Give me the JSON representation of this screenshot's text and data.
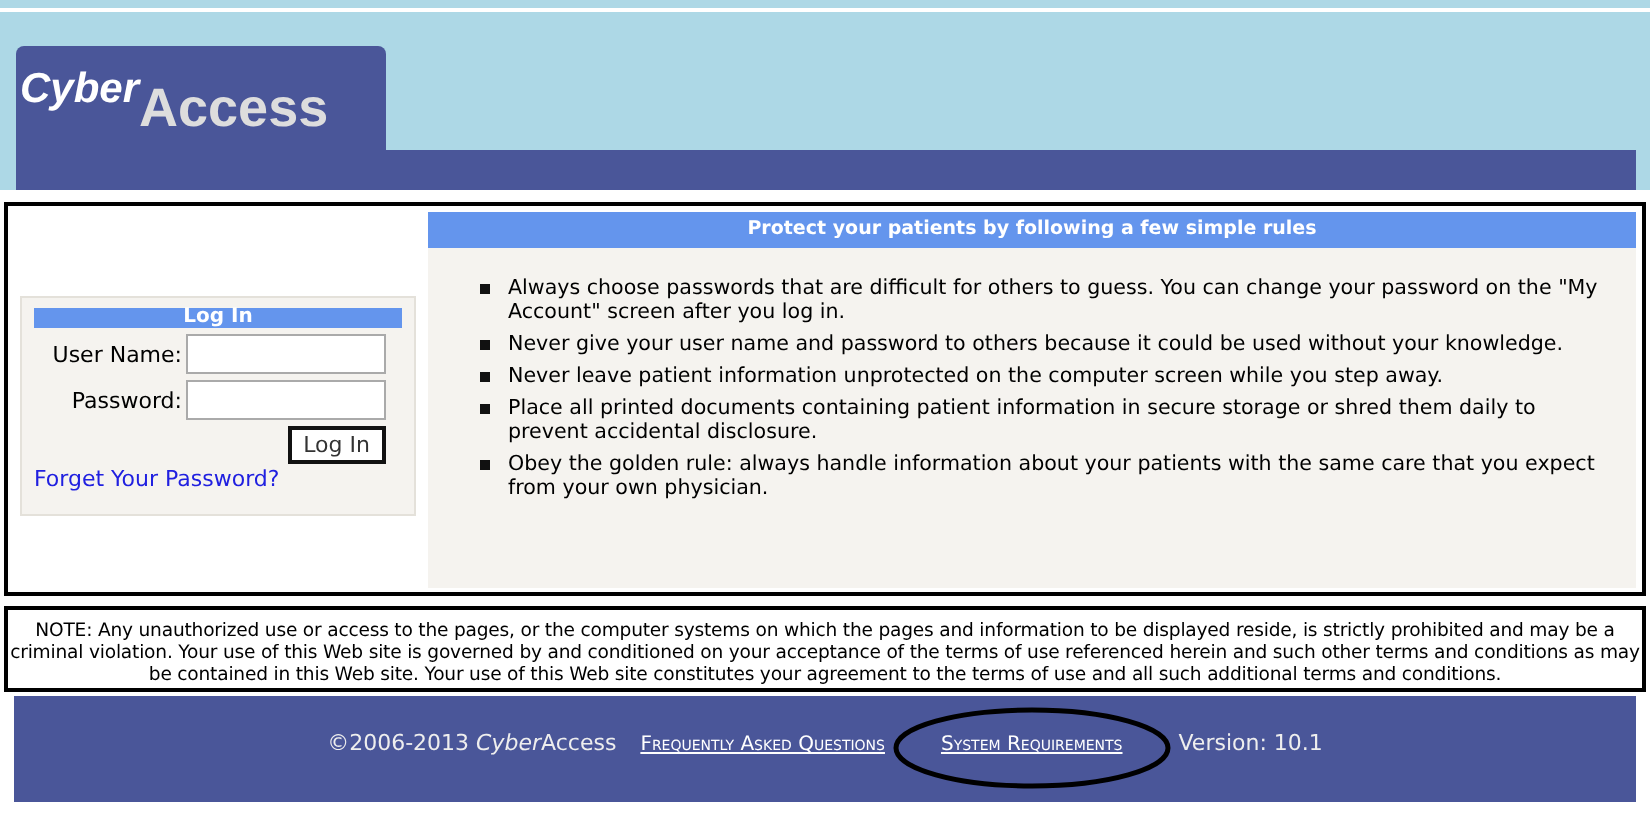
{
  "logo": {
    "first": "Cyber",
    "second": "Access"
  },
  "login": {
    "title": "Log In",
    "fields": [
      {
        "label": "User Name:"
      },
      {
        "label": "Password:"
      }
    ],
    "button": "Log In",
    "link": "Forget Your Password?"
  },
  "rules": {
    "title": "Protect your patients by following a few simple rules",
    "items": [
      "Always choose passwords that are difficult for others to guess. You can change your password on the \"My Account\" screen after you log in.",
      "Never give your user name and password to others because it could be used without your knowledge.",
      "Never leave patient information unprotected on the computer screen while you step away.",
      "Place all printed documents containing patient information in secure storage or shred them daily to prevent accidental disclosure.",
      "Obey the golden rule: always handle information about your patients with the same care that you expect from your own physician."
    ]
  },
  "note": "NOTE: Any unauthorized use or access to the pages, or the computer systems on which the pages and information to be displayed reside, is strictly prohibited and may be a criminal violation. Your use of this Web site is governed by and conditioned on your acceptance of the terms of use referenced herein  and such other terms and conditions as may be contained in this Web site. Your use of this Web site constitutes your agreement to the terms of use and all such additional terms and conditions.",
  "footer": {
    "copyright": [
      {
        "text": "©2006-2013 ",
        "italic": false
      },
      {
        "text": "Cyber",
        "italic": true
      },
      {
        "text": "Access",
        "italic": false
      }
    ],
    "links": [
      "Frequently Asked Questions",
      "System Requirements"
    ],
    "version": "Version: 10.1"
  }
}
